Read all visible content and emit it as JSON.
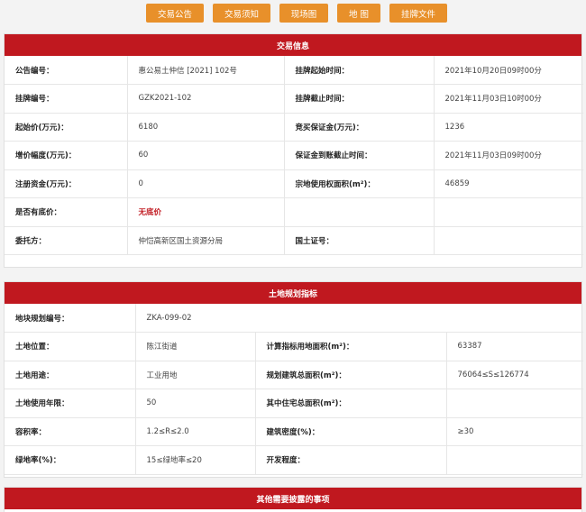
{
  "tabs": [
    "交易公告",
    "交易须知",
    "现场图",
    "地 图",
    "挂牌文件"
  ],
  "trade": {
    "title": "交易信息",
    "rows": [
      [
        "公告编号：",
        "惠公易土仲信 [2021] 102号",
        "挂牌起始时间：",
        "2021年10月20日09时00分"
      ],
      [
        "挂牌编号：",
        "GZK2021-102",
        "挂牌截止时间：",
        "2021年11月03日10时00分"
      ],
      [
        "起始价(万元)：",
        "6180",
        "竞买保证金(万元)：",
        "1236"
      ],
      [
        "增价幅度(万元)：",
        "60",
        "保证金到账截止时间：",
        "2021年11月03日09时00分"
      ],
      [
        "注册资金(万元)：",
        "0",
        "宗地使用权面积(m²)：",
        "46859"
      ],
      [
        "是否有底价：",
        "无底价",
        "",
        ""
      ],
      [
        "委托方：",
        "仲恺高新区国土资源分局",
        "国土证号：",
        ""
      ]
    ]
  },
  "land": {
    "title": "土地规划指标",
    "plot_no_label": "地块规划编号：",
    "plot_no": "ZKA-099-02",
    "rows": [
      [
        "土地位置：",
        "陈江街道",
        "计算指标用地面积(m²)：",
        "63387"
      ],
      [
        "土地用途：",
        "工业用地",
        "规划建筑总面积(m²)：",
        "76064≤S≤126774"
      ],
      [
        "土地使用年限：",
        "50",
        "其中住宅总面积(m²)：",
        ""
      ],
      [
        "容积率：",
        "1.2≤R≤2.0",
        "建筑密度(%)：",
        "≥30"
      ],
      [
        "绿地率(%)：",
        "15≤绿地率≤20",
        "开发程度：",
        ""
      ]
    ]
  },
  "other": {
    "title": "其他需要披露的事项"
  },
  "colors": {
    "accent": "#c0181f",
    "tab": "#e8902a"
  }
}
